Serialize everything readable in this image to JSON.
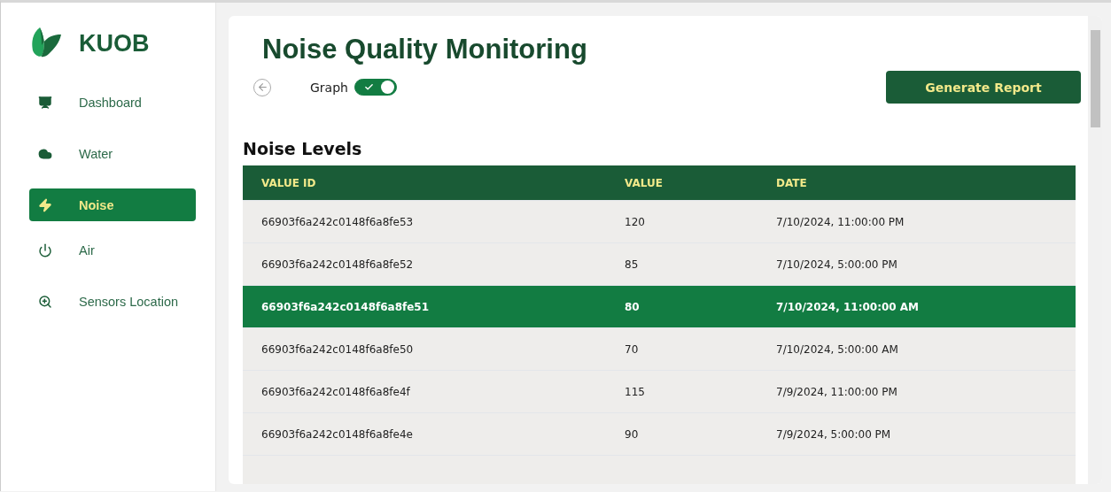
{
  "brand": {
    "name": "KUOB"
  },
  "sidebar": {
    "items": [
      {
        "label": "Dashboard",
        "kind": "dashboard",
        "selected": false
      },
      {
        "label": "Water",
        "kind": "water",
        "selected": false
      },
      {
        "label": "Noise",
        "kind": "noise",
        "selected": true
      },
      {
        "label": "Air",
        "kind": "air",
        "selected": false
      },
      {
        "label": "Sensors Location",
        "kind": "location",
        "selected": false
      }
    ]
  },
  "page": {
    "title": "Noise Quality Monitoring",
    "graph_toggle": {
      "label": "Graph",
      "on": true
    },
    "report_button": "Generate Report"
  },
  "table": {
    "title": "Noise Levels",
    "columns": [
      "VALUE ID",
      "VALUE",
      "DATE"
    ],
    "rows": [
      {
        "cells": [
          "66903f6a242c0148f6a8fe53",
          "120",
          "7/10/2024, 11:00:00 PM"
        ],
        "selected": false
      },
      {
        "cells": [
          "66903f6a242c0148f6a8fe52",
          "85",
          "7/10/2024, 5:00:00 PM"
        ],
        "selected": false
      },
      {
        "cells": [
          "66903f6a242c0148f6a8fe51",
          "80",
          "7/10/2024, 11:00:00 AM"
        ],
        "selected": true
      },
      {
        "cells": [
          "66903f6a242c0148f6a8fe50",
          "70",
          "7/10/2024, 5:00:00 AM"
        ],
        "selected": false
      },
      {
        "cells": [
          "66903f6a242c0148f6a8fe4f",
          "115",
          "7/9/2024, 11:00:00 PM"
        ],
        "selected": false
      },
      {
        "cells": [
          "66903f6a242c0148f6a8fe4e",
          "90",
          "7/9/2024, 5:00:00 PM"
        ],
        "selected": false
      }
    ]
  }
}
